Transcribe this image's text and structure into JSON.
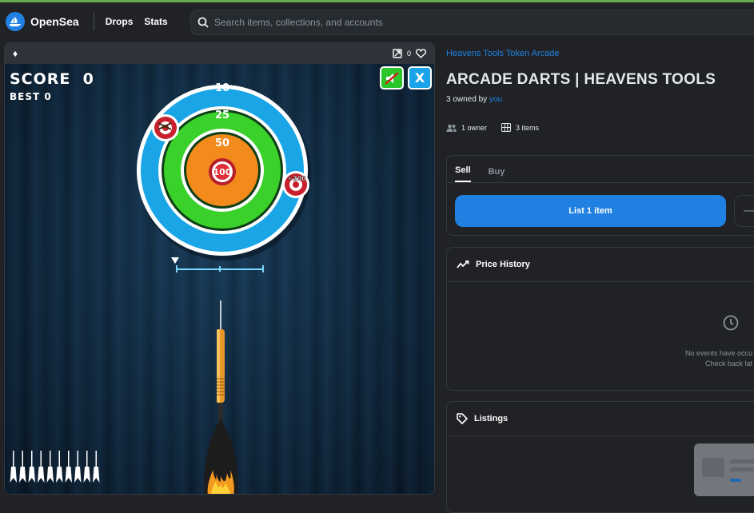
{
  "nav": {
    "brand": "OpenSea",
    "links": [
      "Drops",
      "Stats"
    ],
    "search_placeholder": "Search items, collections, and accounts"
  },
  "asset": {
    "favorite_count": "0",
    "game": {
      "score_label": "SCORE",
      "score_value": "0",
      "best_label": "BEST",
      "best_value": "0",
      "close_label": "X",
      "ring_values": [
        "10",
        "25",
        "50",
        "100"
      ],
      "bonus_label": "+200",
      "darts_remaining": 10
    }
  },
  "detail": {
    "collection": "Heavens Tools Token Arcade",
    "title": "ARCADE DARTS | HEAVENS TOOLS",
    "owned_prefix": "3 owned by",
    "owned_by": "you",
    "owners": "1 owner",
    "items": "3 items",
    "tabs": [
      "Sell",
      "Buy"
    ],
    "list_button": "List 1 item",
    "more_button": "—",
    "price_history": "Price History",
    "no_events": "No events have occu",
    "check_back": "Check back lat",
    "listings": "Listings"
  },
  "colors": {
    "accent": "#2081e2",
    "bg": "#202225",
    "panel_border": "#353840",
    "ring_outer": "#1aa6e6",
    "ring_mid": "#3bd12b",
    "ring_inner": "#f28a1c"
  }
}
